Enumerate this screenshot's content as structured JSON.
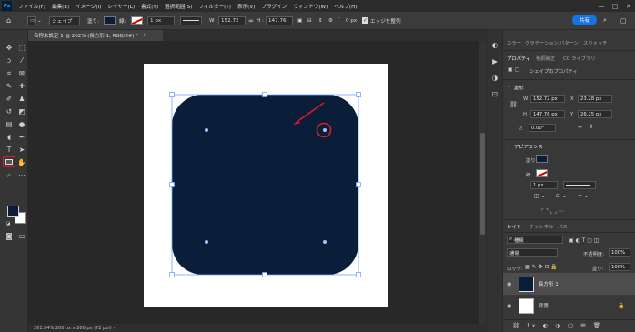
{
  "app": {
    "logo": "Ps"
  },
  "menubar": {
    "items": [
      "ファイル(F)",
      "編集(E)",
      "イメージ(I)",
      "レイヤー(L)",
      "書式(Y)",
      "選択範囲(S)",
      "フィルター(T)",
      "表示(V)",
      "プラグイン",
      "ウィンドウ(W)",
      "ヘルプ(H)"
    ],
    "minimize": "—",
    "maximize": "□",
    "close": "✕"
  },
  "options": {
    "mode": "シェイプ",
    "fill_label": "塗り:",
    "stroke_label": "線:",
    "stroke_width": "1 px",
    "w_label": "W :",
    "w_value": "152.72",
    "link_icon": "link-icon",
    "h_label": "H :",
    "h_value": "147.76",
    "corner": "0 px",
    "align_edges": "エッジを整列",
    "share": "共有",
    "fill_color": "#0a1e3a",
    "stroke_color": "#ffffff"
  },
  "document": {
    "tab_title": "名称未設定 1 @ 262% (長方形 1, RGB/8#) *",
    "close": "×"
  },
  "status": {
    "text": "261.54%    200 px x 200 px (72 ppi)    ›"
  },
  "tools": {
    "active": "rectangle-tool",
    "fg_color": "#0a1e3a",
    "bg_color": "#ffffff"
  },
  "panels": {
    "top_tabs": [
      "カラー",
      "グラデーション",
      "パターン",
      "スウォッチ"
    ],
    "props_tabs": [
      "プロパティ",
      "色調補正",
      "CC ライブラリ"
    ],
    "props_header": "シェイプのプロパティ",
    "transform": {
      "title": "変形",
      "w_label": "W",
      "w": "152.72 px",
      "x_label": "X",
      "x": "23.28 px",
      "h_label": "H",
      "h": "147.76 px",
      "y_label": "Y",
      "y": "26.25 px",
      "angle": "0.00°"
    },
    "appearance": {
      "title": "アピアランス",
      "fill_label": "塗り",
      "stroke_label": "線",
      "stroke_width": "1 px"
    },
    "layers_tabs": [
      "レイヤー",
      "チャンネル",
      "パス"
    ],
    "kind": "種類",
    "blend": "通常",
    "opacity_label": "不透明度:",
    "opacity": "100%",
    "lock_label": "ロック:",
    "fill_label": "塗り:",
    "fill": "100%",
    "layers": [
      {
        "name": "長方形 1"
      },
      {
        "name": "背景"
      }
    ]
  }
}
